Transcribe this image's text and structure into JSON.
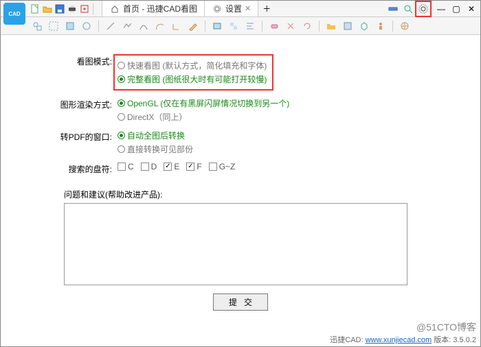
{
  "titlebar": {
    "tabs": [
      {
        "icon": "home",
        "label": "首页 - 迅捷CAD看图"
      },
      {
        "icon": "gear",
        "label": "设置"
      }
    ]
  },
  "settings": {
    "view_mode": {
      "label": "看图模式:",
      "opt1": "快速看图 (默认方式，简化填充和字体)",
      "opt2": "完整看图 (图纸很大时有可能打开较慢)"
    },
    "render": {
      "label": "图形渲染方式:",
      "opt1": "OpenGL (仅在有黑屏闪屏情况切换到另一个)",
      "opt2": "DirectX（同上）"
    },
    "pdf_window": {
      "label": "转PDF的窗口:",
      "opt1": "自动全图后转换",
      "opt2": "直接转换可见部份"
    },
    "drives": {
      "label": "搜索的盘符:",
      "c": "C",
      "d": "D",
      "e": "E",
      "f": "F",
      "gz": "G~Z"
    },
    "feedback_label": "问题和建议(帮助改进产品):",
    "submit": "提交"
  },
  "footer": {
    "prefix": "迅捷CAD: ",
    "link": "www.xunjiecad.com",
    "suffix": " 版本: 3.5.0.2"
  },
  "watermark": "@51CTO博客"
}
